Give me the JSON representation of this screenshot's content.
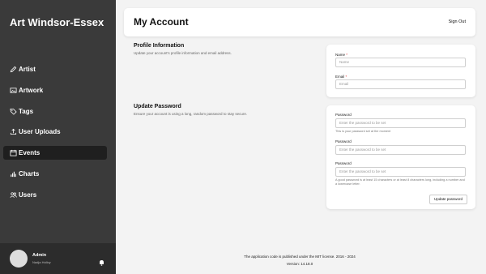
{
  "sidebar": {
    "title": "Art Windsor-Essex",
    "items": [
      {
        "label": "Artist",
        "icon": "pencil-icon",
        "active": false
      },
      {
        "label": "Artwork",
        "icon": "image-icon",
        "active": false
      },
      {
        "label": "Tags",
        "icon": "tag-icon",
        "active": false
      },
      {
        "label": "User Uploads",
        "icon": "upload-icon",
        "active": false
      },
      {
        "label": "Events",
        "icon": "calendar-icon",
        "active": true
      },
      {
        "label": "Charts",
        "icon": "bar-chart-icon",
        "active": false
      },
      {
        "label": "Users",
        "icon": "users-icon",
        "active": false
      }
    ],
    "user": {
      "name": "Admin",
      "subtitle": "Nadja Holloy"
    }
  },
  "header": {
    "title": "My Account",
    "sign_out": "Sign Out"
  },
  "profile": {
    "title": "Profile Information",
    "description": "Update your account's profile information and email address.",
    "name_label": "Name",
    "name_placeholder": "Name",
    "email_label": "Email",
    "email_placeholder": "Email"
  },
  "password": {
    "title": "Update Password",
    "description": "Ensure your account is using a long, random password to stay secure.",
    "fields": [
      {
        "label": "Password",
        "placeholder": "Enter the password to be set",
        "help": "This is your password set at the moment"
      },
      {
        "label": "Password",
        "placeholder": "Enter the password to be set",
        "help": ""
      },
      {
        "label": "Password",
        "placeholder": "Enter the password to be set",
        "help": "A good password is at least 15 characters or at least 8 characters long, including a number and a lowercase letter."
      }
    ],
    "button": "Update password"
  },
  "footer": {
    "license": "The application code is published under the MIT license. 2016 - 2024",
    "version": "Version: 14.18.0"
  },
  "colors": {
    "sidebar_bg": "#3a3a3a",
    "active_item_bg": "#1f1f1f",
    "page_bg": "#f3f3f3",
    "required": "#dd3333"
  }
}
